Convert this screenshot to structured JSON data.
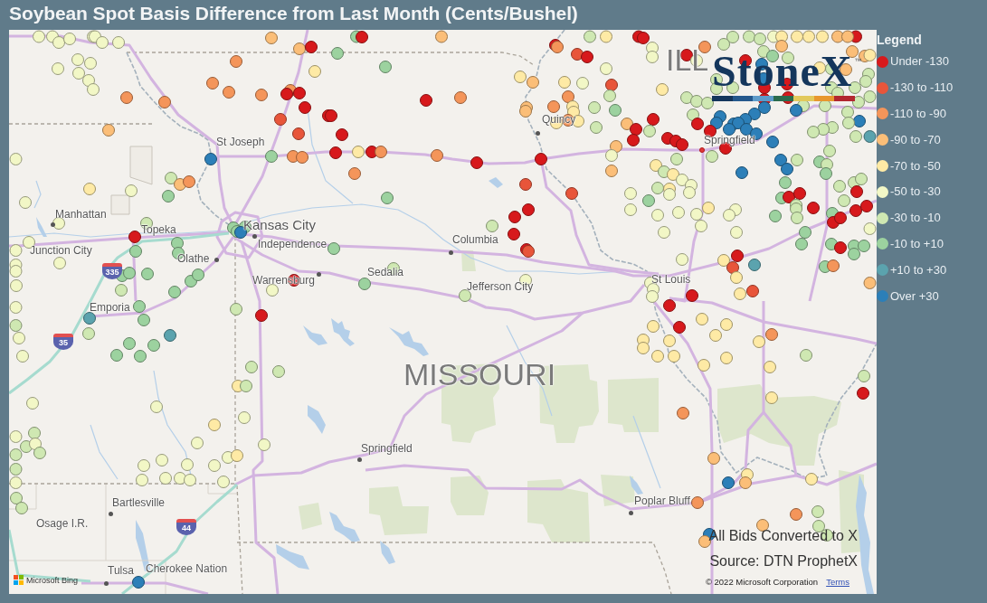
{
  "title": "Soybean Spot Basis Difference from Last Month (Cents/Bushel)",
  "map": {
    "labels": [
      {
        "text": "ILL",
        "kind": "state"
      },
      {
        "text": "Quincy",
        "kind": "town"
      },
      {
        "text": "St Joseph",
        "kind": "place"
      },
      {
        "text": "Springfield",
        "kind": "capital"
      },
      {
        "text": "Manhattan",
        "kind": "town"
      },
      {
        "text": "Kansas City",
        "kind": "metro"
      },
      {
        "text": "Topeka",
        "kind": "place"
      },
      {
        "text": "Columbia",
        "kind": "town"
      },
      {
        "text": "Independence",
        "kind": "town"
      },
      {
        "text": "Junction City",
        "kind": "place"
      },
      {
        "text": "Olathe",
        "kind": "town"
      },
      {
        "text": "Sedalia",
        "kind": "place"
      },
      {
        "text": "Warrensburg",
        "kind": "town"
      },
      {
        "text": "St Louis",
        "kind": "place"
      },
      {
        "text": "Jefferson City",
        "kind": "place"
      },
      {
        "text": "Emporia",
        "kind": "place"
      },
      {
        "text": "MISSOURI",
        "kind": "state"
      },
      {
        "text": "Springfield",
        "kind": "town"
      },
      {
        "text": "Poplar Bluff",
        "kind": "town"
      },
      {
        "text": "Bartlesville",
        "kind": "town"
      },
      {
        "text": "Osage I.R.",
        "kind": "region"
      },
      {
        "text": "Tulsa",
        "kind": "town"
      },
      {
        "text": "Cherokee Nation",
        "kind": "region"
      }
    ],
    "shields": [
      {
        "text": "335"
      },
      {
        "text": "35"
      },
      {
        "text": "44"
      }
    ],
    "markers": [
      {
        "color": "#f2f7c6"
      },
      {
        "color": "#f2f7c6"
      },
      {
        "color": "#f2f7c6"
      },
      {
        "color": "#f2f7c6"
      },
      {
        "color": "#f2f7c6"
      },
      {
        "color": "#f2f7c6"
      },
      {
        "color": "#f2f7c6"
      },
      {
        "color": "#f2f7c6"
      },
      {
        "color": "#f2f7c6"
      },
      {
        "color": "#f2f7c6"
      },
      {
        "color": "#f2f7c6"
      },
      {
        "color": "#f2f7c6"
      },
      {
        "color": "#f2f7c6"
      },
      {
        "color": "#f2f7c6"
      },
      {
        "color": "#f4955a"
      },
      {
        "color": "#f4955a"
      },
      {
        "color": "#fbbe78"
      },
      {
        "color": "#fbbe78"
      },
      {
        "color": "#fbbe78"
      },
      {
        "color": "#d7191c"
      },
      {
        "color": "#feeaa5"
      },
      {
        "color": "#f4955a"
      },
      {
        "color": "#f4955a"
      },
      {
        "color": "#f4955a"
      },
      {
        "color": "#f4955a"
      },
      {
        "color": "#f4955a"
      },
      {
        "color": "#d7191c"
      },
      {
        "color": "#d7191c"
      },
      {
        "color": "#d7191c"
      },
      {
        "color": "#e8553a"
      },
      {
        "color": "#d7191c"
      },
      {
        "color": "#e8553a"
      },
      {
        "color": "#2c7fb8"
      },
      {
        "color": "#9cd29f"
      },
      {
        "color": "#f4955a"
      },
      {
        "color": "#f4955a"
      },
      {
        "color": "#f2f7c6"
      },
      {
        "color": "#feeaa5"
      },
      {
        "color": "#f2f7c6"
      },
      {
        "color": "#cfe8b2"
      },
      {
        "color": "#fbbe78"
      },
      {
        "color": "#f4955a"
      },
      {
        "color": "#9cd29f"
      },
      {
        "color": "#f2f7c6"
      },
      {
        "color": "#f2f7c6"
      },
      {
        "color": "#cfe8b2"
      },
      {
        "color": "#d7191c"
      },
      {
        "color": "#9cd29f"
      },
      {
        "color": "#9cd29f"
      },
      {
        "color": "#9cd29f"
      },
      {
        "color": "#9cd29f"
      },
      {
        "color": "#9cd29f"
      },
      {
        "color": "#9cd29f"
      },
      {
        "color": "#2c7fb8"
      },
      {
        "color": "#f2f7c6"
      },
      {
        "color": "#f2f7c6"
      },
      {
        "color": "#f2f7c6"
      },
      {
        "color": "#f2f7c6"
      },
      {
        "color": "#f2f7c6"
      },
      {
        "color": "#f2f7c6"
      },
      {
        "color": "#9cd29f"
      },
      {
        "color": "#9cd29f"
      },
      {
        "color": "#9cd29f"
      },
      {
        "color": "#cfe8b2"
      },
      {
        "color": "#9cd29f"
      },
      {
        "color": "#9cd29f"
      },
      {
        "color": "#9cd29f"
      },
      {
        "color": "#d7191c"
      },
      {
        "color": "#f2f7c6"
      },
      {
        "color": "#9cd29f"
      },
      {
        "color": "#d7191c"
      },
      {
        "color": "#fbbe78"
      },
      {
        "color": "#9cd29f"
      },
      {
        "color": "#9cd29f"
      },
      {
        "color": "#d7191c"
      },
      {
        "color": "#f4955a"
      },
      {
        "color": "#d7191c"
      },
      {
        "color": "#d7191c"
      },
      {
        "color": "#d7191c"
      },
      {
        "color": "#feeaa5"
      },
      {
        "color": "#d7191c"
      },
      {
        "color": "#f4955a"
      },
      {
        "color": "#f4955a"
      },
      {
        "color": "#d7191c"
      },
      {
        "color": "#d7191c"
      },
      {
        "color": "#f4955a"
      },
      {
        "color": "#9cd29f"
      },
      {
        "color": "#e8553a"
      },
      {
        "color": "#e8553a"
      },
      {
        "color": "#d7191c"
      },
      {
        "color": "#d7191c"
      },
      {
        "color": "#d7191c"
      },
      {
        "color": "#d7191c"
      },
      {
        "color": "#e8553a"
      },
      {
        "color": "#cfe8b2"
      },
      {
        "color": "#9cd29f"
      },
      {
        "color": "#cfe8b2"
      },
      {
        "color": "#9cd29f"
      },
      {
        "color": "#cfe8b2"
      },
      {
        "color": "#f2f7c6"
      },
      {
        "color": "#d7191c"
      },
      {
        "color": "#f4955a"
      },
      {
        "color": "#e8553a"
      },
      {
        "color": "#d7191c"
      },
      {
        "color": "#feeaa5"
      },
      {
        "color": "#d7191c"
      },
      {
        "color": "#d7191c"
      },
      {
        "color": "#cfe8b2"
      },
      {
        "color": "#f2f7c6"
      },
      {
        "color": "#f2f7c6"
      },
      {
        "color": "#f2f7c6"
      },
      {
        "color": "#feeaa5"
      },
      {
        "color": "#fbbe78"
      },
      {
        "color": "#feeaa5"
      },
      {
        "color": "#f2f7c6"
      },
      {
        "color": "#e8553a"
      },
      {
        "color": "#cfe8b2"
      },
      {
        "color": "#f4955a"
      },
      {
        "color": "#f4955a"
      },
      {
        "color": "#feeaa5"
      },
      {
        "color": "#feeaa5"
      },
      {
        "color": "#fbbe78"
      },
      {
        "color": "#fbbe78"
      },
      {
        "color": "#cfe8b2"
      },
      {
        "color": "#9cd29f"
      },
      {
        "color": "#feeaa5"
      },
      {
        "color": "#f4955a"
      },
      {
        "color": "#feeaa5"
      },
      {
        "color": "#cfe8b2"
      },
      {
        "color": "#fbbe78"
      },
      {
        "color": "#d7191c"
      },
      {
        "color": "#d7191c"
      },
      {
        "color": "#cfe8b2"
      },
      {
        "color": "#d7191c"
      },
      {
        "color": "#fbbe78"
      },
      {
        "color": "#f2f7c6"
      },
      {
        "color": "#fbbe78"
      },
      {
        "color": "#feeaa5"
      },
      {
        "color": "#f2f7c6"
      },
      {
        "color": "#9cd29f"
      },
      {
        "color": "#f2f7c6"
      },
      {
        "color": "#cfe8b2"
      },
      {
        "color": "#f2f7c6"
      },
      {
        "color": "#f2f7c6"
      },
      {
        "color": "#f2f7c6"
      },
      {
        "color": "#f2f7c6"
      },
      {
        "color": "#f4955a"
      },
      {
        "color": "#d7191c"
      },
      {
        "color": "#cfe8b2"
      },
      {
        "color": "#cfe8b2"
      },
      {
        "color": "#cfe8b2"
      },
      {
        "color": "#cfe8b2"
      },
      {
        "color": "#f2f7c6"
      },
      {
        "color": "#feeaa5"
      },
      {
        "color": "#feeaa5"
      },
      {
        "color": "#feeaa5"
      },
      {
        "color": "#feeaa5"
      },
      {
        "color": "#fbbe78"
      },
      {
        "color": "#d7191c"
      },
      {
        "color": "#fbbe78"
      },
      {
        "color": "#fbbe78"
      },
      {
        "color": "#cfe8b2"
      },
      {
        "color": "#9cd29f"
      },
      {
        "color": "#cfe8b2"
      },
      {
        "color": "#fbbe78"
      },
      {
        "color": "#fbbe78"
      },
      {
        "color": "#feeaa5"
      },
      {
        "color": "#f2f7c6"
      },
      {
        "color": "#d7191c"
      },
      {
        "color": "#2c7fb8"
      },
      {
        "color": "#feeaa5"
      },
      {
        "color": "#cfe8b2"
      },
      {
        "color": "#fbbe78"
      },
      {
        "color": "#cfe8b2"
      },
      {
        "color": "#cfe8b2"
      },
      {
        "color": "#feeaa5"
      },
      {
        "color": "#cfe8b2"
      },
      {
        "color": "#cfe8b2"
      },
      {
        "color": "#cfe8b2"
      },
      {
        "color": "#d7191c"
      },
      {
        "color": "#d7191c"
      },
      {
        "color": "#2c7fb8"
      },
      {
        "color": "#cfe8b2"
      },
      {
        "color": "#cfe8b2"
      },
      {
        "color": "#cfe8b2"
      },
      {
        "color": "#cfe8b2"
      },
      {
        "color": "#cfe8b2"
      },
      {
        "color": "#cfe8b2"
      },
      {
        "color": "#cfe8b2"
      },
      {
        "color": "#d7191c"
      },
      {
        "color": "#d7191c"
      },
      {
        "color": "#cfe8b2"
      },
      {
        "color": "#cfe8b2"
      },
      {
        "color": "#cfe8b2"
      },
      {
        "color": "#2c7fb8"
      },
      {
        "color": "#2c7fb8"
      },
      {
        "color": "#2c7fb8"
      },
      {
        "color": "#2c7fb8"
      },
      {
        "color": "#2c7fb8"
      },
      {
        "color": "#2c7fb8"
      },
      {
        "color": "#2c7fb8"
      },
      {
        "color": "#2c7fb8"
      },
      {
        "color": "#2c7fb8"
      },
      {
        "color": "#2c7fb8"
      },
      {
        "color": "#2c7fb8"
      },
      {
        "color": "#2c7fb8"
      },
      {
        "color": "#2c7fb8"
      },
      {
        "color": "#5ba3ae"
      },
      {
        "color": "#cfe8b2"
      },
      {
        "color": "#cfe8b2"
      },
      {
        "color": "#cfe8b2"
      },
      {
        "color": "#cfe8b2"
      },
      {
        "color": "#cfe8b2"
      },
      {
        "color": "#cfe8b2"
      },
      {
        "color": "#cfe8b2"
      },
      {
        "color": "#d7191c"
      },
      {
        "color": "#d7191c"
      },
      {
        "color": "#d7191c"
      },
      {
        "color": "#d7191c"
      },
      {
        "color": "#d7191c"
      },
      {
        "color": "#d7191c"
      },
      {
        "color": "#cfe8b2"
      },
      {
        "color": "#cfe8b2"
      },
      {
        "color": "#cfe8b2"
      },
      {
        "color": "#feeaa5"
      },
      {
        "color": "#f2f7c6"
      },
      {
        "color": "#f2f7c6"
      },
      {
        "color": "#f2f7c6"
      },
      {
        "color": "#feeaa5"
      },
      {
        "color": "#f2f7c6"
      },
      {
        "color": "#2c7fb8"
      },
      {
        "color": "#2c7fb8"
      },
      {
        "color": "#2c7fb8"
      },
      {
        "color": "#cfe8b2"
      },
      {
        "color": "#9cd29f"
      },
      {
        "color": "#cfe8b2"
      },
      {
        "color": "#cfe8b2"
      },
      {
        "color": "#9cd29f"
      },
      {
        "color": "#9cd29f"
      },
      {
        "color": "#cfe8b2"
      },
      {
        "color": "#cfe8b2"
      },
      {
        "color": "#cfe8b2"
      },
      {
        "color": "#d7191c"
      },
      {
        "color": "#cfe8b2"
      },
      {
        "color": "#9cd29f"
      },
      {
        "color": "#d7191c"
      },
      {
        "color": "#d7191c"
      },
      {
        "color": "#cfe8b2"
      },
      {
        "color": "#cfe8b2"
      },
      {
        "color": "#cfe8b2"
      },
      {
        "color": "#d7191c"
      },
      {
        "color": "#9cd29f"
      },
      {
        "color": "#9cd29f"
      },
      {
        "color": "#d7191c"
      },
      {
        "color": "#d7191c"
      },
      {
        "color": "#d7191c"
      },
      {
        "color": "#d7191c"
      },
      {
        "color": "#f2f7c6"
      },
      {
        "color": "#9cd29f"
      },
      {
        "color": "#9cd29f"
      },
      {
        "color": "#9cd29f"
      },
      {
        "color": "#d7191c"
      },
      {
        "color": "#9cd29f"
      },
      {
        "color": "#9cd29f"
      },
      {
        "color": "#9cd29f"
      },
      {
        "color": "#9cd29f"
      },
      {
        "color": "#f4955a"
      },
      {
        "color": "#fbbe78"
      },
      {
        "color": "#feeaa5"
      },
      {
        "color": "#f2f7c6"
      },
      {
        "color": "#f2f7c6"
      },
      {
        "color": "#f2f7c6"
      },
      {
        "color": "#f2f7c6"
      },
      {
        "color": "#f2f7c6"
      },
      {
        "color": "#f2f7c6"
      },
      {
        "color": "#f2f7c6"
      },
      {
        "color": "#f2f7c6"
      },
      {
        "color": "#feeaa5"
      },
      {
        "color": "#d7191c"
      },
      {
        "color": "#e8553a"
      },
      {
        "color": "#feeaa5"
      },
      {
        "color": "#5ba3ae"
      },
      {
        "color": "#e8553a"
      },
      {
        "color": "#feeaa5"
      },
      {
        "color": "#d7191c"
      },
      {
        "color": "#d7191c"
      },
      {
        "color": "#d7191c"
      },
      {
        "color": "#feeaa5"
      },
      {
        "color": "#feeaa5"
      },
      {
        "color": "#feeaa5"
      },
      {
        "color": "#feeaa5"
      },
      {
        "color": "#feeaa5"
      },
      {
        "color": "#feeaa5"
      },
      {
        "color": "#feeaa5"
      },
      {
        "color": "#feeaa5"
      },
      {
        "color": "#feeaa5"
      },
      {
        "color": "#f4955a"
      },
      {
        "color": "#feeaa5"
      },
      {
        "color": "#cfe8b2"
      },
      {
        "color": "#cfe8b2"
      },
      {
        "color": "#d7191c"
      },
      {
        "color": "#feeaa5"
      },
      {
        "color": "#f4955a"
      },
      {
        "color": "#fbbe78"
      },
      {
        "color": "#2c7fb8"
      },
      {
        "color": "#feeaa5"
      },
      {
        "color": "#fbbe78"
      },
      {
        "color": "#feeaa5"
      },
      {
        "color": "#f4955a"
      },
      {
        "color": "#f4955a"
      },
      {
        "color": "#cfe8b2"
      },
      {
        "color": "#cfe8b2"
      },
      {
        "color": "#fbbe78"
      },
      {
        "color": "#2c7fb8"
      },
      {
        "color": "#fbbe78"
      },
      {
        "color": "#cfe8b2"
      },
      {
        "color": "#feeaa5"
      },
      {
        "color": "#feeaa5"
      },
      {
        "color": "#feeaa5"
      },
      {
        "color": "#f2f7c6"
      },
      {
        "color": "#5ba3ae"
      },
      {
        "color": "#9cd29f"
      },
      {
        "color": "#9cd29f"
      },
      {
        "color": "#cfe8b2"
      },
      {
        "color": "#f2f7c6"
      },
      {
        "color": "#cfe8b2"
      },
      {
        "color": "#5ba3ae"
      },
      {
        "color": "#9cd29f"
      },
      {
        "color": "#9cd29f"
      },
      {
        "color": "#9cd29f"
      },
      {
        "color": "#9cd29f"
      },
      {
        "color": "#f2f7c6"
      },
      {
        "color": "#cfe8b2"
      },
      {
        "color": "#d7191c"
      },
      {
        "color": "#cfe8b2"
      },
      {
        "color": "#cfe8b2"
      },
      {
        "color": "#feeaa5"
      },
      {
        "color": "#cfe8b2"
      },
      {
        "color": "#f2f7c6"
      },
      {
        "color": "#f2f7c6"
      },
      {
        "color": "#f2f7c6"
      },
      {
        "color": "#feeaa5"
      },
      {
        "color": "#cfe8b2"
      },
      {
        "color": "#f2f7c6"
      },
      {
        "color": "#cfe8b2"
      },
      {
        "color": "#f2f7c6"
      },
      {
        "color": "#cfe8b2"
      },
      {
        "color": "#cfe8b2"
      },
      {
        "color": "#cfe8b2"
      },
      {
        "color": "#f2f7c6"
      },
      {
        "color": "#f2f7c6"
      },
      {
        "color": "#f2f7c6"
      },
      {
        "color": "#feeaa5"
      },
      {
        "color": "#f2f7c6"
      },
      {
        "color": "#f2f7c6"
      },
      {
        "color": "#f2f7c6"
      },
      {
        "color": "#f2f7c6"
      },
      {
        "color": "#f2f7c6"
      },
      {
        "color": "#f2f7c6"
      },
      {
        "color": "#f2f7c6"
      },
      {
        "color": "#f2f7c6"
      },
      {
        "color": "#f2f7c6"
      },
      {
        "color": "#f2f7c6"
      },
      {
        "color": "#cfe8b2"
      },
      {
        "color": "#cfe8b2"
      },
      {
        "color": "#2c7fb8"
      }
    ],
    "logo": {
      "wordmark": "StoneX",
      "trademark": "™"
    },
    "notes": [
      "All Bids Converted to X",
      "Source: DTN ProphetX"
    ],
    "provider": "Microsoft Bing",
    "copyright": "© 2022 Microsoft Corporation",
    "terms_link": "Terms"
  },
  "legend": {
    "title": "Legend",
    "items": [
      {
        "label": "Under -130",
        "color": "#d7191c"
      },
      {
        "label": "-130 to -110",
        "color": "#e8553a"
      },
      {
        "label": "-110 to -90",
        "color": "#f4955a"
      },
      {
        "label": "-90 to -70",
        "color": "#fbbe78"
      },
      {
        "label": "-70 to -50",
        "color": "#feeaa5"
      },
      {
        "label": "-50 to -30",
        "color": "#f2f7c6"
      },
      {
        "label": "-30 to -10",
        "color": "#cfe8b2"
      },
      {
        "label": "-10 to +10",
        "color": "#9cd29f"
      },
      {
        "label": "+10 to +30",
        "color": "#5ba3ae"
      },
      {
        "label": "Over +30",
        "color": "#2c7fb8"
      }
    ]
  }
}
